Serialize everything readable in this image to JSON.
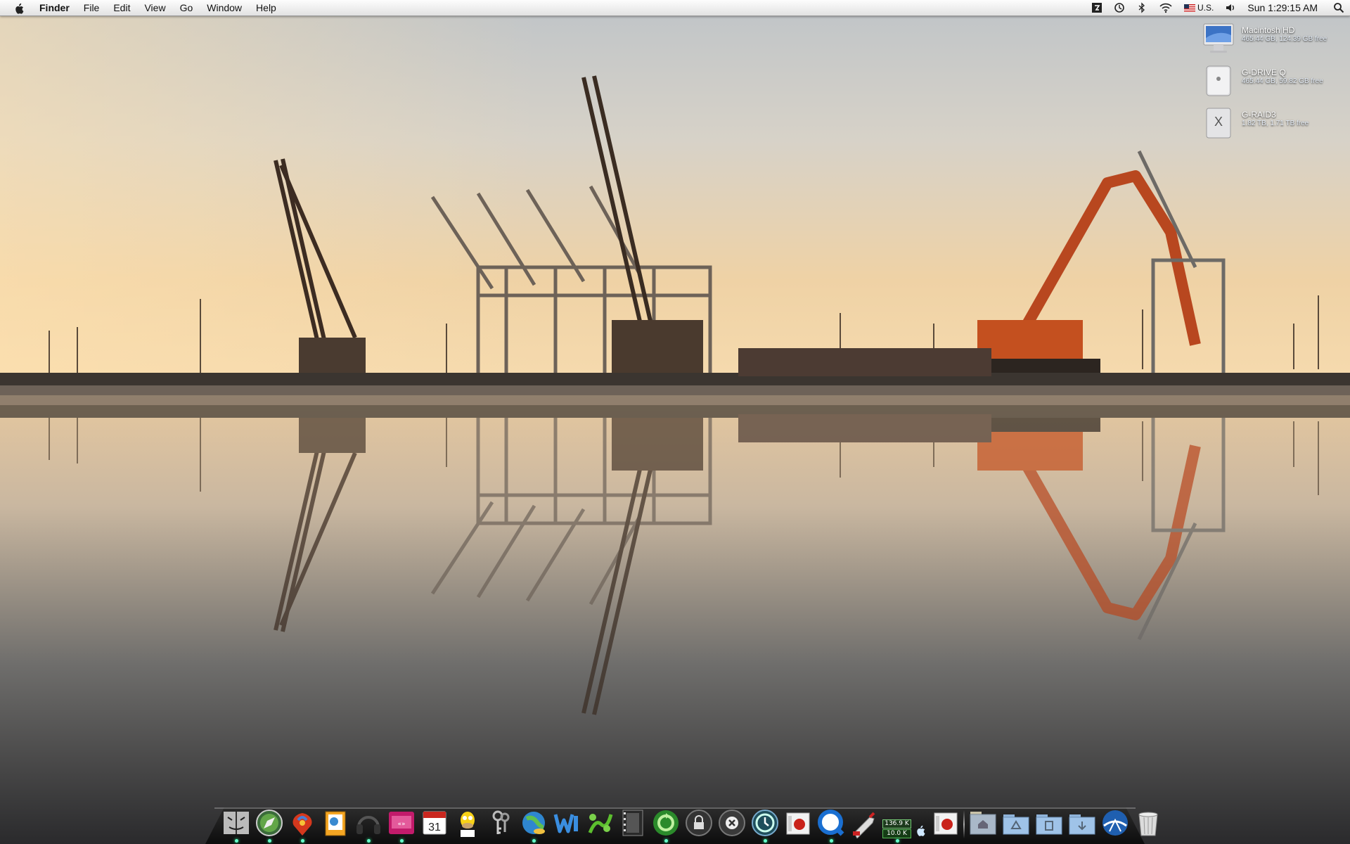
{
  "menubar": {
    "app_name": "Finder",
    "menus": [
      "File",
      "Edit",
      "View",
      "Go",
      "Window",
      "Help"
    ],
    "input_source": "U.S.",
    "clock": "Sun 1:29:15 AM"
  },
  "desktop": {
    "drives": [
      {
        "name": "Macintosh HD",
        "info": "465.44 GB, 124.39 GB free",
        "icon": "imac-drive-icon"
      },
      {
        "name": "G-DRIVE Q",
        "info": "465.44 GB, 59.82 GB free",
        "icon": "external-drive-icon"
      },
      {
        "name": "G-RAID3",
        "info": "1.82 TB, 1.71 TB free",
        "icon": "x-drive-icon"
      }
    ]
  },
  "dock": {
    "network_monitor": {
      "upload": "136.9 K",
      "download": "10.0 K"
    },
    "items": [
      "finder-icon",
      "safari-icon",
      "phoenix-icon",
      "preview-icon",
      "headphones-icon",
      "itunes-icon",
      "calendar-icon",
      "homer-icon",
      "keychain-icon",
      "network-globe-icon",
      "word-icon",
      "vine-icon",
      "film-icon",
      "sync-icon",
      "lock-icon",
      "close-circle-icon",
      "time-machine-icon",
      "apple-box-icon",
      "quicktime-icon",
      "rocket-icon",
      "network-monitor-icon",
      "apple-box-2-icon",
      "home-folder-icon",
      "recycle-folder-icon",
      "documents-folder-icon",
      "downloads-folder-icon",
      "apps-icon",
      "trash-icon"
    ]
  },
  "colors": {
    "sky_top": "#c8ccd0",
    "sky_horizon": "#f6d9ad",
    "crane_orange": "#d8542a",
    "dock_glow": "#66ffcc"
  }
}
